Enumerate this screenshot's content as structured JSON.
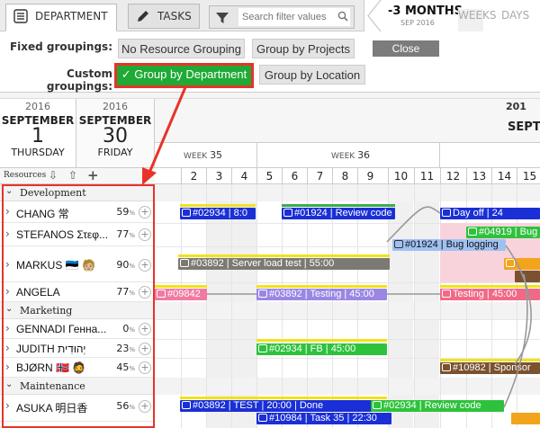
{
  "toolbar": {
    "tab_department": "DEPARTMENT",
    "tab_tasks": "TASKS",
    "search_placeholder": "Search filter values",
    "period_label": "-3 MONTHS",
    "period_sub": "SEP 2016",
    "weeks": "WEEKS",
    "days": "DAYS"
  },
  "groupings": {
    "fixed_label": "Fixed groupings:",
    "custom_label": "Custom groupings:",
    "no_grouping": "No Resource Grouping",
    "by_projects": "Group by Projects",
    "close": "Close",
    "by_department": "✓ Group by Department",
    "by_location": "Group by Location"
  },
  "dates": {
    "start": {
      "year": "2016",
      "month": "SEPTEMBER",
      "day": "1",
      "weekday": "THURSDAY"
    },
    "end": {
      "year": "2016",
      "month": "SEPTEMBER",
      "day": "30",
      "weekday": "FRIDAY"
    }
  },
  "timeline": {
    "year": "201",
    "month": "SEPT",
    "weeks": [
      {
        "prefix": "WEEK",
        "num": "35"
      },
      {
        "prefix": "WEEK",
        "num": "36"
      }
    ],
    "days": [
      "2",
      "3",
      "4",
      "5",
      "6",
      "7",
      "8",
      "9",
      "10",
      "11",
      "12",
      "13",
      "14",
      "15"
    ]
  },
  "resources_header": "Resources",
  "groups": [
    {
      "name": "Development",
      "rows": [
        {
          "name": "CHANG 常",
          "pct": "59",
          "unit": "%"
        },
        {
          "name": "STEFANOS Στεφ...",
          "pct": "77",
          "unit": "%"
        },
        {
          "name": "MARKUS 🇪🇪 🧑🏼",
          "pct": "90",
          "unit": "%"
        },
        {
          "name": "ANGELA",
          "pct": "77",
          "unit": "%"
        }
      ]
    },
    {
      "name": "Marketing",
      "rows": [
        {
          "name": "GENNADI Генна...",
          "pct": "0",
          "unit": "%"
        },
        {
          "name": "JUDITH יְהוּדִית",
          "pct": "23",
          "unit": "%"
        },
        {
          "name": "BJØRN 🇳🇴 🧔",
          "pct": "45",
          "unit": "%"
        }
      ]
    },
    {
      "name": "Maintenance",
      "rows": [
        {
          "name": "ASUKA 明日香",
          "pct": "56",
          "unit": "%"
        }
      ]
    }
  ],
  "tasks": [
    {
      "label": "#02934 | 8:0",
      "color": "#1a2fd6"
    },
    {
      "label": "#01924 | Review code",
      "color": "#1a2fd6"
    },
    {
      "label": "Day off | 24",
      "color": "#1a2fd6"
    },
    {
      "label": "#04919 | Bug",
      "color": "#2ec23c"
    },
    {
      "label": "#01924 | Bug logging",
      "color": "#9fc1f2"
    },
    {
      "label": "#03892 | Server load test | 55:00",
      "color": "#7a7a72"
    },
    {
      "label": "#09842",
      "color": "#f27aa0"
    },
    {
      "label": "#03892 | Testing | 45:00",
      "color": "#9b86e4"
    },
    {
      "label": "Testing | 45:00",
      "color": "#f06a86"
    },
    {
      "label": "#02934 | FB | 45:00",
      "color": "#2ec23c"
    },
    {
      "label": "#10982 | Sponsor",
      "color": "#7a5230"
    },
    {
      "label": "#03892 | TEST | 20:00 | Done",
      "color": "#1a2fd6"
    },
    {
      "label": "#02934 | Review code",
      "color": "#2ec23c"
    },
    {
      "label": "#10984 | Task 35 | 22:30",
      "color": "#1a2fd6"
    }
  ]
}
